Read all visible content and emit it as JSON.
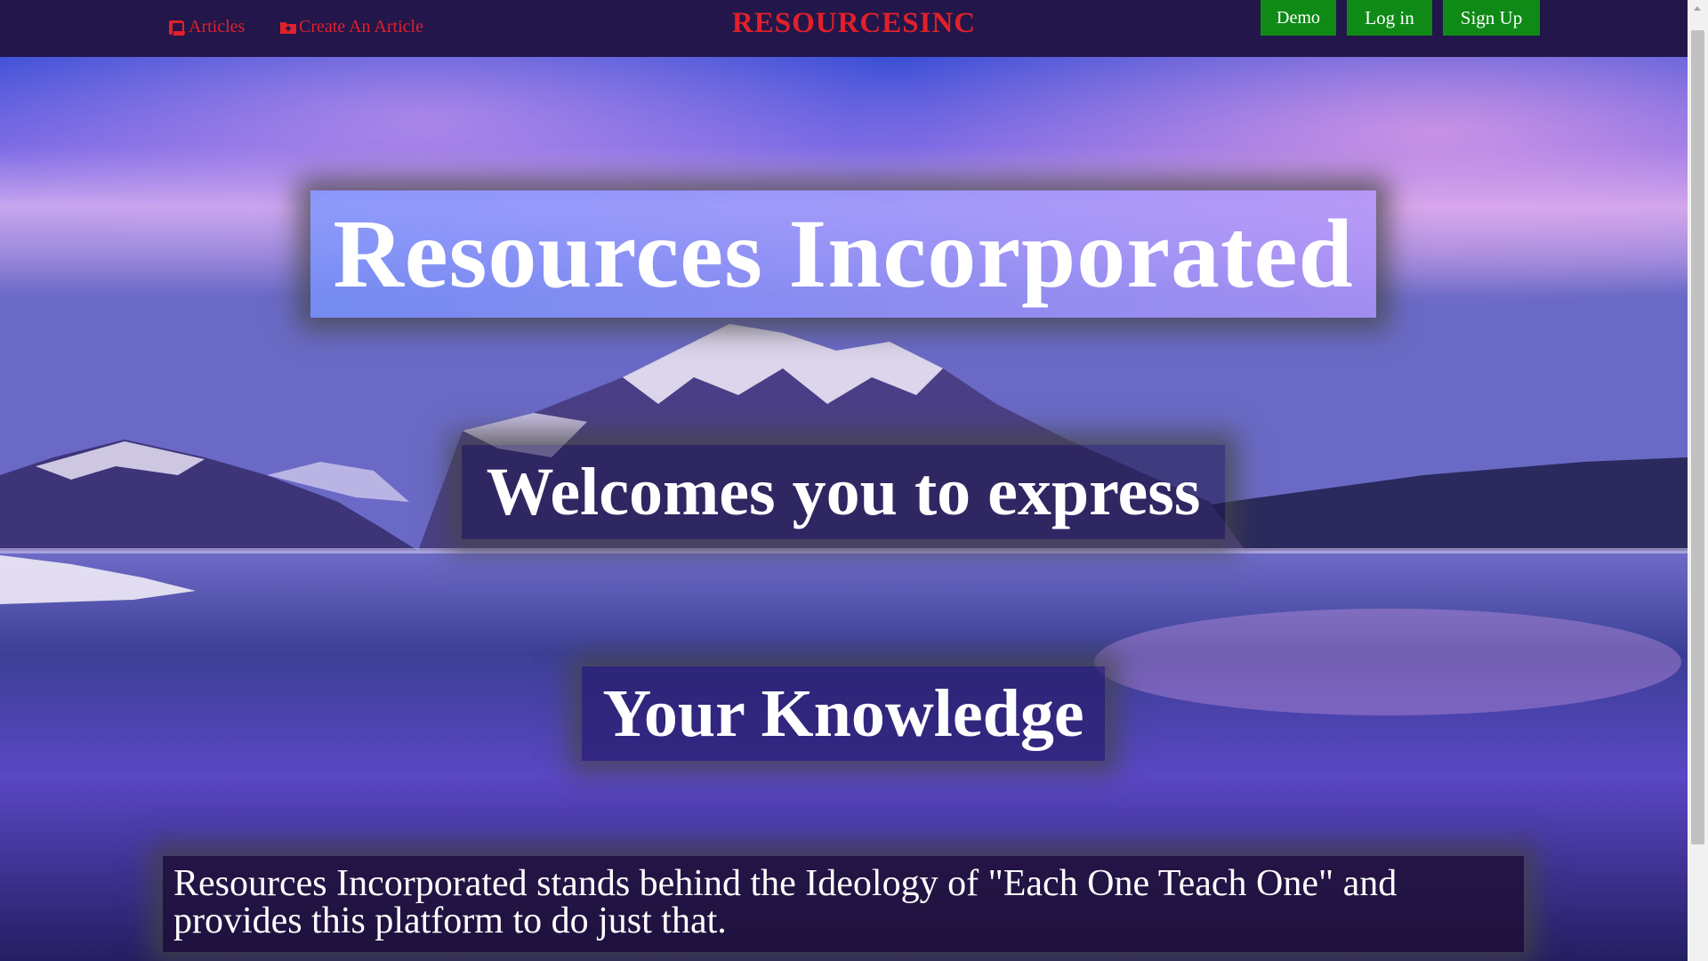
{
  "nav": {
    "articles_label": "Articles",
    "create_label": "Create An Article",
    "brand": "RESOURCESINC",
    "demo_label": "Demo",
    "login_label": "Log in",
    "signup_label": "Sign Up"
  },
  "hero": {
    "title": "Resources Incorporated",
    "line2": "Welcomes you to express",
    "line3": "Your Knowledge",
    "description": "Resources Incorporated stands behind the Ideology of \"Each One Teach One\" and provides this platform to do just that."
  },
  "icons": {
    "articles": "scroll-icon",
    "create": "folder-plus-icon"
  },
  "colors": {
    "navbar_bg": "#23164a",
    "link_red": "#e0202a",
    "button_green": "#0f8a17"
  }
}
